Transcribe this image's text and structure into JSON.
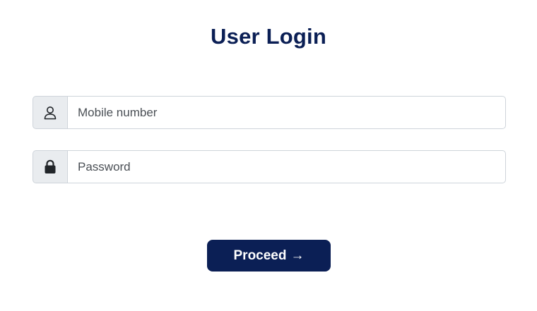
{
  "login": {
    "title": "User Login",
    "mobile": {
      "placeholder": "Mobile number",
      "value": "",
      "icon": "user-icon"
    },
    "password": {
      "placeholder": "Password",
      "value": "",
      "icon": "lock-icon"
    },
    "submit": {
      "label": "Proceed",
      "arrow": "→"
    }
  },
  "colors": {
    "brand_navy": "#0b1f55",
    "addon_bg": "#e9ecef",
    "border": "#ced4da"
  }
}
